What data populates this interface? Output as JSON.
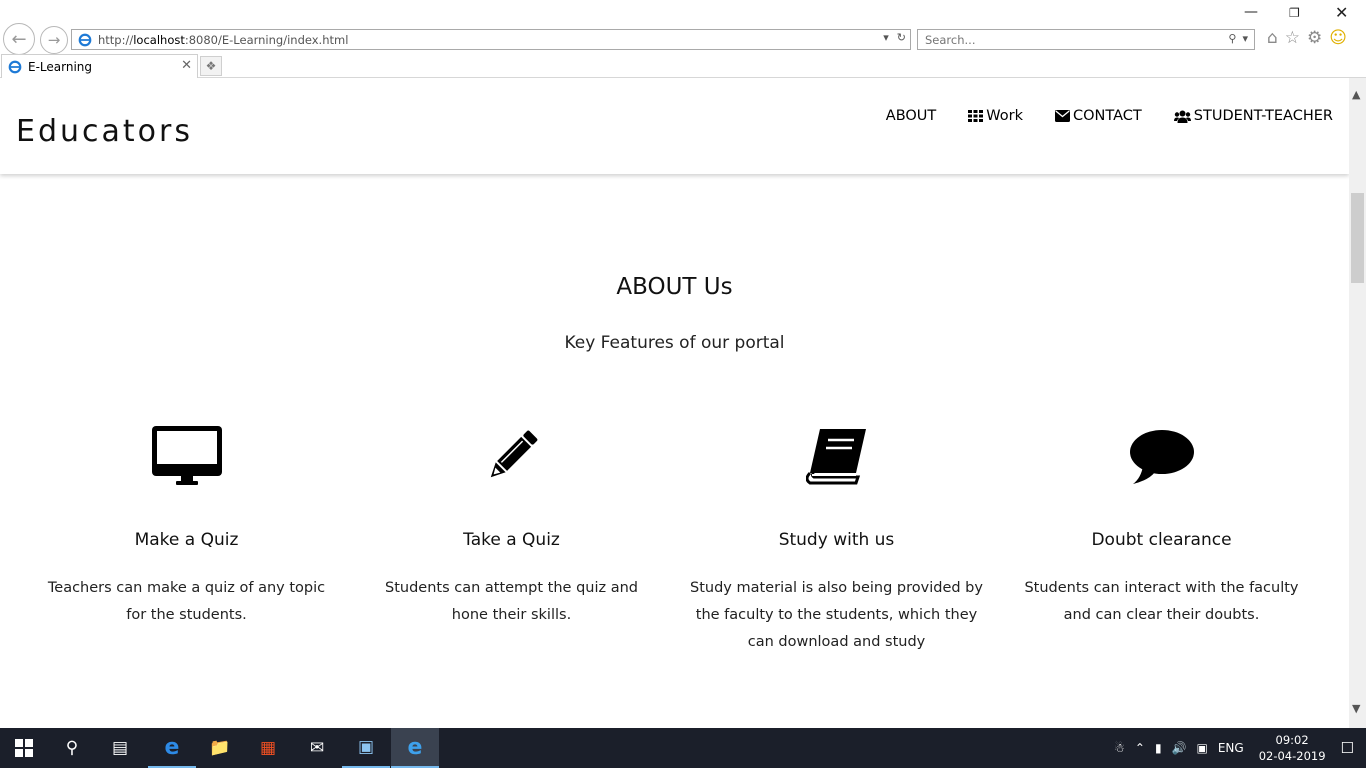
{
  "browser": {
    "url_prefix": "http://",
    "url_host": "localhost",
    "url_rest": ":8080/E-Learning/index.html",
    "search_placeholder": "Search...",
    "tab_title": "E-Learning"
  },
  "site": {
    "brand": "Educators",
    "nav": [
      {
        "label": "ABOUT",
        "icon": "none"
      },
      {
        "label": "Work",
        "icon": "th-grid-icon"
      },
      {
        "label": " CONTACT",
        "icon": "envelope-icon"
      },
      {
        "label": "STUDENT-TEACHER",
        "icon": "users-icon"
      }
    ]
  },
  "about": {
    "title": "ABOUT Us",
    "subtitle": "Key Features of our portal",
    "features": [
      {
        "icon": "desktop-icon",
        "title": "Make a Quiz",
        "desc": "Teachers can make a quiz of any topic for the students."
      },
      {
        "icon": "pencil-icon",
        "title": "Take a Quiz",
        "desc": "Students can attempt the quiz and hone their skills."
      },
      {
        "icon": "book-icon",
        "title": "Study with us",
        "desc": "Study material is also being provided by the faculty to the students, which they can download and study"
      },
      {
        "icon": "comment-icon",
        "title": "Doubt clearance",
        "desc": "Students can interact with the faculty and can clear their doubts."
      }
    ]
  },
  "taskbar": {
    "language": "ENG",
    "time": "09:02",
    "date": "02-04-2019"
  }
}
